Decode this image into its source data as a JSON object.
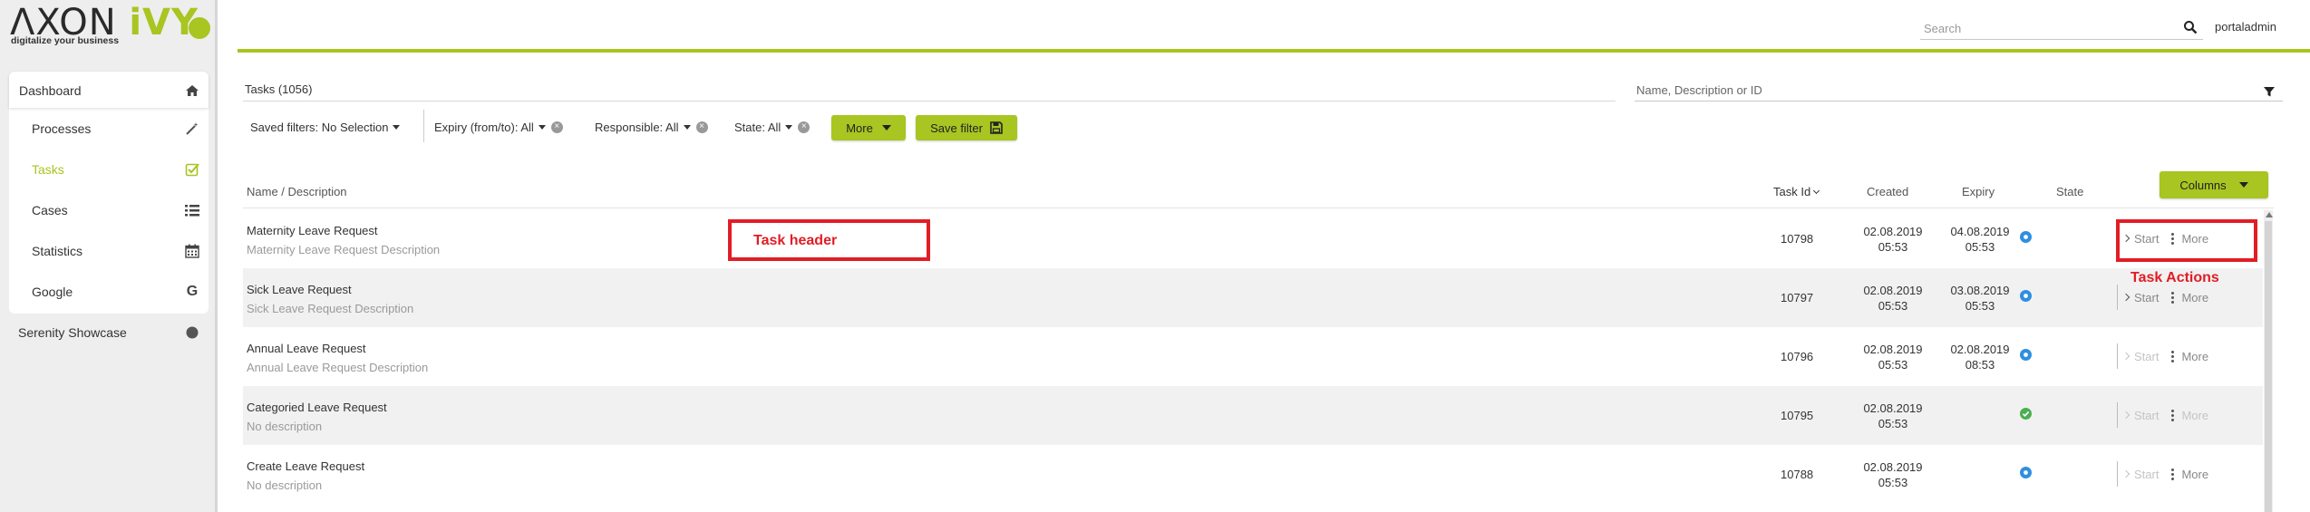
{
  "brand": {
    "logo_main": "ΛXON ",
    "logo_accent": "iVY",
    "tagline": "digitalize your business",
    "accent_color": "#a8c521"
  },
  "sidebar": {
    "items": [
      {
        "label": "Dashboard",
        "icon": "home-icon"
      },
      {
        "label": "Processes",
        "icon": "magic-wand-icon"
      },
      {
        "label": "Tasks",
        "icon": "check-square-icon",
        "active": true
      },
      {
        "label": "Cases",
        "icon": "list-icon"
      },
      {
        "label": "Statistics",
        "icon": "calendar-icon"
      },
      {
        "label": "Google",
        "icon": "google-icon"
      },
      {
        "label": "Serenity Showcase",
        "icon": "circle-icon"
      }
    ]
  },
  "header": {
    "search_placeholder": "Search",
    "user_name": "portaladmin"
  },
  "tasks": {
    "title": "Tasks (1056)",
    "filter_placeholder": "Name, Description or ID"
  },
  "filters": {
    "saved": "Saved filters: No Selection",
    "expiry": "Expiry (from/to): All",
    "responsible": "Responsible: All",
    "state": "State: All",
    "more_label": "More",
    "save_filter_label": "Save filter"
  },
  "table": {
    "columns_button": "Columns",
    "headers": {
      "name": "Name / Description",
      "task_id": "Task Id",
      "created": "Created",
      "expiry": "Expiry",
      "state": "State"
    },
    "rows": [
      {
        "name": "Maternity Leave Request",
        "description": "Maternity Leave Request Description",
        "task_id": "10798",
        "created_date": "02.08.2019",
        "created_time": "05:53",
        "expiry_date": "04.08.2019",
        "expiry_time": "05:53",
        "state": "open",
        "start": "Start",
        "more": "More",
        "start_enabled": true,
        "more_enabled": true
      },
      {
        "name": "Sick Leave Request",
        "description": "Sick Leave Request Description",
        "task_id": "10797",
        "created_date": "02.08.2019",
        "created_time": "05:53",
        "expiry_date": "03.08.2019",
        "expiry_time": "05:53",
        "state": "open",
        "start": "Start",
        "more": "More",
        "start_enabled": true,
        "more_enabled": true
      },
      {
        "name": "Annual Leave Request",
        "description": "Annual Leave Request Description",
        "task_id": "10796",
        "created_date": "02.08.2019",
        "created_time": "05:53",
        "expiry_date": "02.08.2019",
        "expiry_time": "08:53",
        "state": "open",
        "start": "Start",
        "more": "More",
        "start_enabled": false,
        "more_enabled": true
      },
      {
        "name": "Categoried Leave Request",
        "description": "No description",
        "task_id": "10795",
        "created_date": "02.08.2019",
        "created_time": "05:53",
        "expiry_date": "",
        "expiry_time": "",
        "state": "done",
        "start": "Start",
        "more": "More",
        "start_enabled": false,
        "more_enabled": false
      },
      {
        "name": "Create Leave Request",
        "description": "No description",
        "task_id": "10788",
        "created_date": "02.08.2019",
        "created_time": "05:53",
        "expiry_date": "",
        "expiry_time": "",
        "state": "open",
        "start": "Start",
        "more": "More",
        "start_enabled": false,
        "more_enabled": true
      }
    ]
  },
  "annotations": {
    "task_header": "Task header",
    "task_actions": "Task Actions",
    "color": "#e11d25"
  },
  "colors": {
    "state_open": "#2f8fe0",
    "state_done": "#4caf50"
  }
}
